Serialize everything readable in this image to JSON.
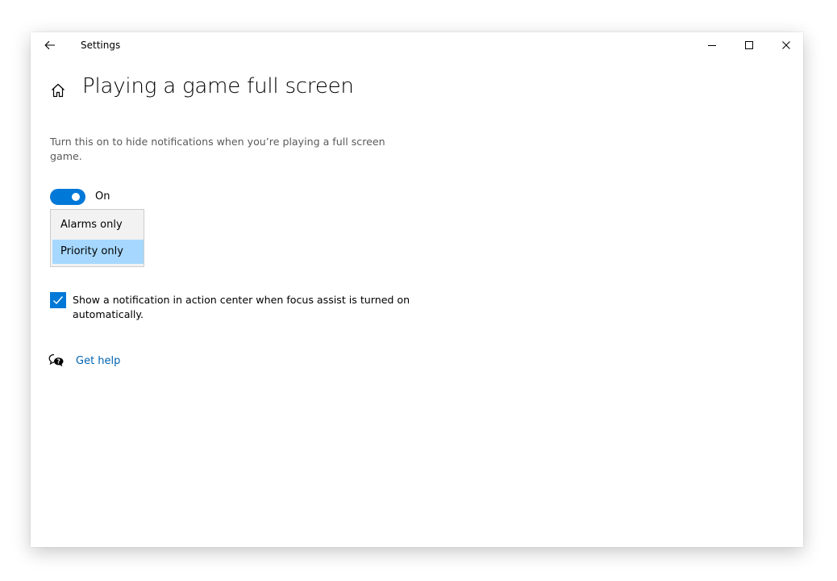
{
  "window": {
    "app_title": "Settings",
    "back_icon": "back-arrow-icon",
    "controls": [
      "minimize-icon",
      "maximize-icon",
      "close-icon"
    ]
  },
  "page": {
    "home_icon": "home-icon",
    "title": "Playing a game full screen",
    "description": "Turn this on to hide notifications when you’re playing a full screen game."
  },
  "toggle": {
    "state": "On",
    "on": true
  },
  "dropdown": {
    "options": [
      "Alarms only",
      "Priority only"
    ],
    "selected": "Priority only"
  },
  "checkbox": {
    "checked": true,
    "label": "Show a notification in action center when focus assist is turned on automatically."
  },
  "help": {
    "icon": "help-chat-icon",
    "label": "Get help"
  },
  "colors": {
    "accent": "#0078d7",
    "link": "#0063b1",
    "highlight": "#a6d8ff"
  }
}
